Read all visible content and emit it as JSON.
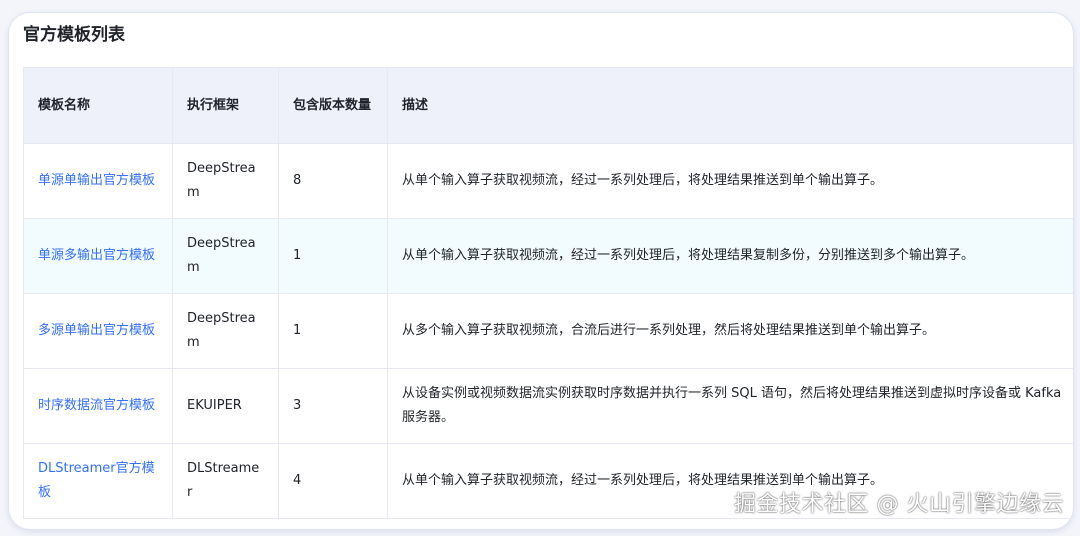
{
  "section_title": "官方模板列表",
  "table": {
    "headers": [
      "模板名称",
      "执行框架",
      "包含版本数量",
      "描述"
    ],
    "rows": [
      {
        "name": "单源单输出官方模板",
        "framework": "DeepStream",
        "versions": "8",
        "description": "从单个输入算子获取视频流，经过一系列处理后，将处理结果推送到单个输出算子。"
      },
      {
        "name": "单源多输出官方模板",
        "framework": "DeepStream",
        "versions": "1",
        "description": "从单个输入算子获取视频流，经过一系列处理后，将处理结果复制多份，分别推送到多个输出算子。"
      },
      {
        "name": "多源单输出官方模板",
        "framework": "DeepStream",
        "versions": "1",
        "description": "从多个输入算子获取视频流，合流后进行一系列处理，然后将处理结果推送到单个输出算子。"
      },
      {
        "name": "时序数据流官方模板",
        "framework": "EKUIPER",
        "versions": "3",
        "description": "从设备实例或视频数据流实例获取时序数据并执行一系列 SQL 语句，然后将处理结果推送到虚拟时序设备或 Kafka 服务器。"
      },
      {
        "name": "DLStreamer官方模板",
        "framework": "DLStreamer",
        "versions": "4",
        "description": "从单个输入算子获取视频流，经过一系列处理后，将处理结果推送到单个输出算子。"
      }
    ]
  },
  "watermark": "掘金技术社区 @ 火山引擎边缘云",
  "colors": {
    "link": "#3370ff",
    "header_bg": "#eef1f9",
    "highlight_row_bg": "#f2fbfd"
  }
}
